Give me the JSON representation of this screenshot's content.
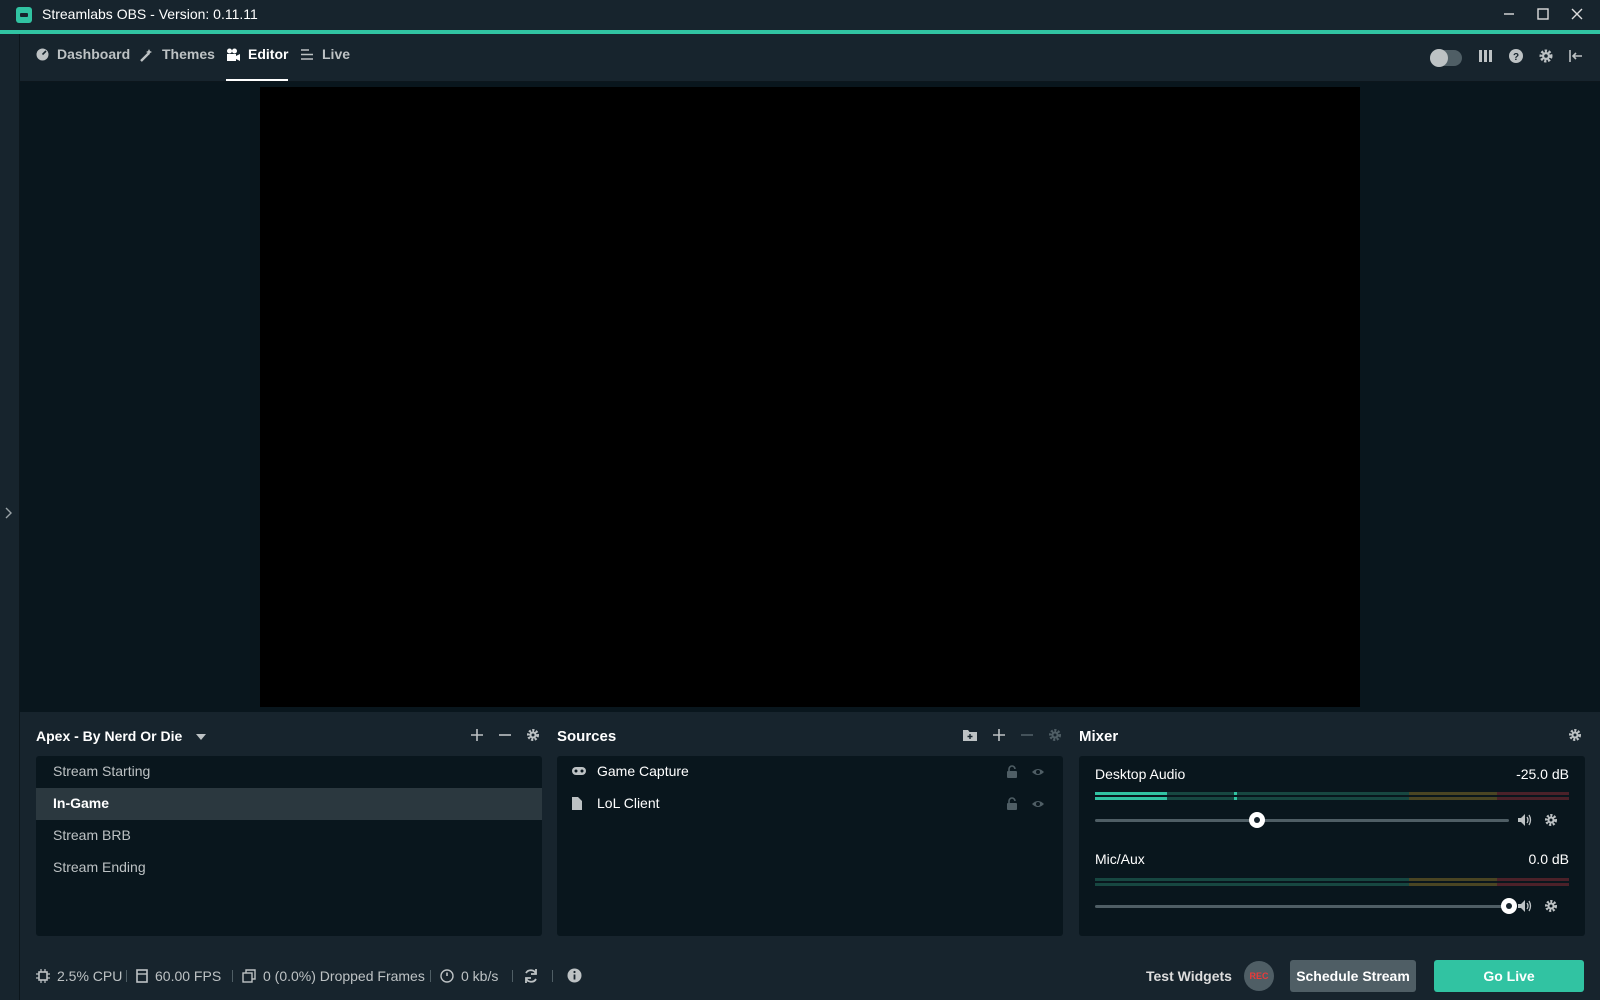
{
  "app": {
    "title": "Streamlabs OBS - Version: 0.11.11",
    "accent_color": "#31c3a2"
  },
  "window_controls": {
    "minimize_icon": "minimize-icon",
    "maximize_icon": "maximize-icon",
    "close_icon": "close-icon"
  },
  "nav": {
    "items": [
      {
        "label": "Dashboard",
        "icon": "dashboard-icon"
      },
      {
        "label": "Themes",
        "icon": "themes-icon"
      },
      {
        "label": "Editor",
        "icon": "editor-icon",
        "active": true
      },
      {
        "label": "Live",
        "icon": "live-icon"
      }
    ],
    "right_icons": [
      "night-mode-toggle",
      "layout-icon",
      "help-icon",
      "settings-icon",
      "collapse-icon"
    ]
  },
  "scenes": {
    "collection_name": "Apex - By Nerd Or Die",
    "items": [
      {
        "label": "Stream Starting"
      },
      {
        "label": "In-Game",
        "active": true
      },
      {
        "label": "Stream BRB"
      },
      {
        "label": "Stream Ending"
      }
    ]
  },
  "sources": {
    "title": "Sources",
    "items": [
      {
        "label": "Game Capture",
        "icon": "gamepad-icon"
      },
      {
        "label": "LoL Client",
        "icon": "file-icon"
      }
    ]
  },
  "mixer": {
    "title": "Mixer",
    "channels": [
      {
        "name": "Desktop Audio",
        "db": "-25.0 dB",
        "volume_fraction": 0.4
      },
      {
        "name": "Mic/Aux",
        "db": "0.0 dB",
        "volume_fraction": 1.0
      }
    ]
  },
  "footer": {
    "cpu": "2.5% CPU",
    "fps": "60.00 FPS",
    "dropped": "0 (0.0%) Dropped Frames",
    "bitrate": "0 kb/s",
    "test_widgets": "Test Widgets",
    "rec": "REC",
    "schedule": "Schedule Stream",
    "go_live": "Go Live"
  }
}
